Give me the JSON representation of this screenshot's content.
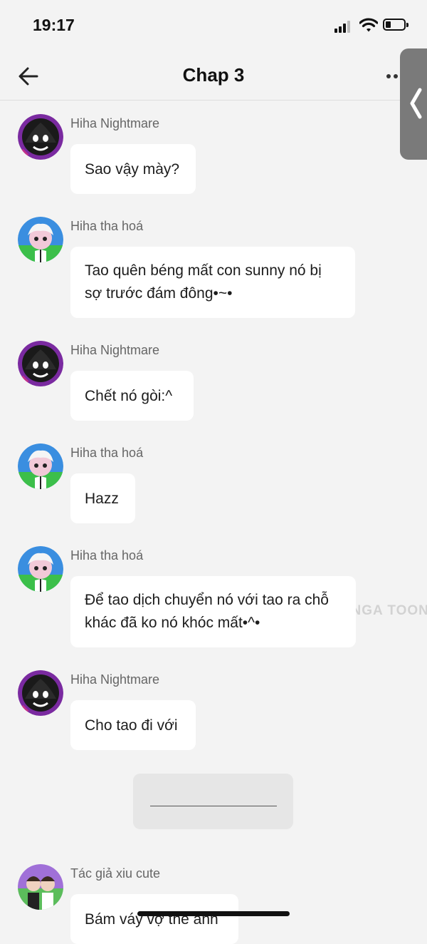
{
  "status_bar": {
    "time": "19:17"
  },
  "header": {
    "title": "Chap 3"
  },
  "messages": [
    {
      "sender": "Hiha Nightmare",
      "text": "Sao vậy mày?"
    },
    {
      "sender": "Hiha tha hoá",
      "text": "Tao quên béng mất con sunny nó bị sợ trước đám đông•~•"
    },
    {
      "sender": "Hiha Nightmare",
      "text": "Chết nó gòi:^"
    },
    {
      "sender": "Hiha tha hoá",
      "text": "Hazz"
    },
    {
      "sender": "Hiha tha hoá",
      "text": "Để tao dịch chuyển nó với tao ra chỗ khác đã ko nó khóc mất•^•"
    },
    {
      "sender": "Hiha Nightmare",
      "text": "Cho tao đi với"
    },
    {
      "sender": "Tác giả xiu cute",
      "text": "Bám váy vợ thế anh"
    }
  ],
  "watermark": "MANGA TOON",
  "colors": {
    "background": "#f3f3f3",
    "bubble": "#ffffff",
    "side_tab": "#7a7a7a",
    "divider_card": "#e6e6e6"
  },
  "icons": [
    "back-arrow-icon",
    "more-dots-icon",
    "side-chevron-icon",
    "signal-icon",
    "wifi-icon",
    "battery-icon"
  ]
}
